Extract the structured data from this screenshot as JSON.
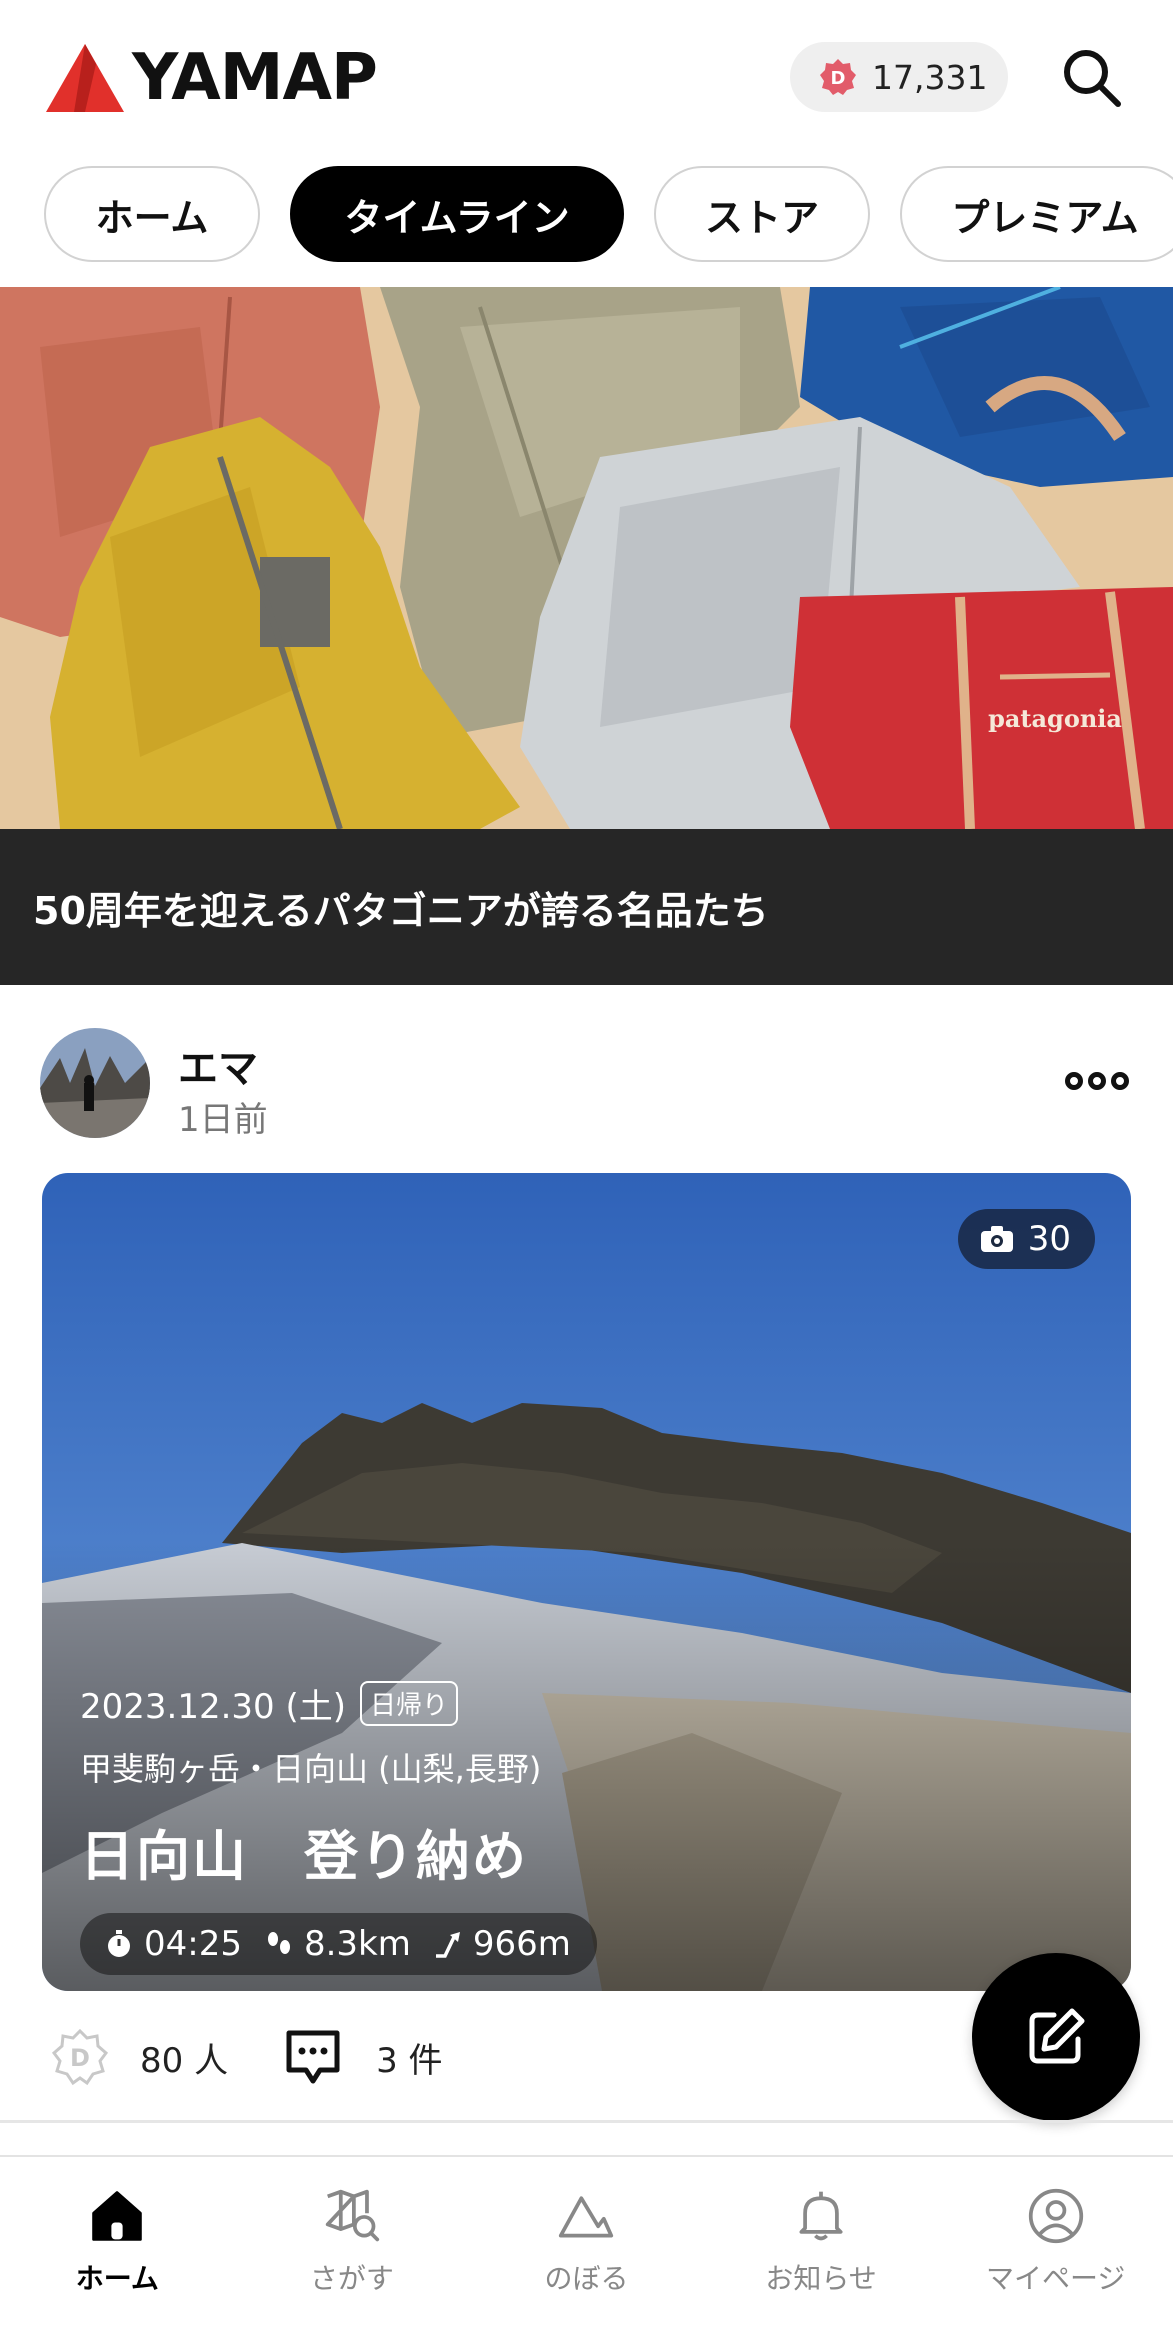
{
  "header": {
    "logo_text": "YAMAP",
    "points": "17,331",
    "accent_color": "#e1302b"
  },
  "tabs": [
    {
      "label": "ホーム",
      "active": false
    },
    {
      "label": "タイムライン",
      "active": true
    },
    {
      "label": "ストア",
      "active": false
    },
    {
      "label": "プレミアム",
      "active": false
    }
  ],
  "banner": {
    "caption": "50周年を迎えるパタゴニアが誇る名品たち",
    "brand_text": "patagonia"
  },
  "post": {
    "username": "エマ",
    "time": "1日前",
    "photo_count": "30",
    "date": "2023.12.30 (土)",
    "badge": "日帰り",
    "area": "甲斐駒ヶ岳・日向山 (山梨,長野)",
    "title": "日向山　登り納め",
    "duration": "04:25",
    "distance": "8.3km",
    "elevation": "966m",
    "reactions_count": "80 人",
    "comments_count": "3 件"
  },
  "nav": [
    {
      "label": "ホーム",
      "icon": "home-icon",
      "active": true
    },
    {
      "label": "さがす",
      "icon": "map-search-icon",
      "active": false
    },
    {
      "label": "のぼる",
      "icon": "mountain-icon",
      "active": false
    },
    {
      "label": "お知らせ",
      "icon": "bell-icon",
      "active": false
    },
    {
      "label": "マイページ",
      "icon": "user-icon",
      "active": false
    }
  ]
}
